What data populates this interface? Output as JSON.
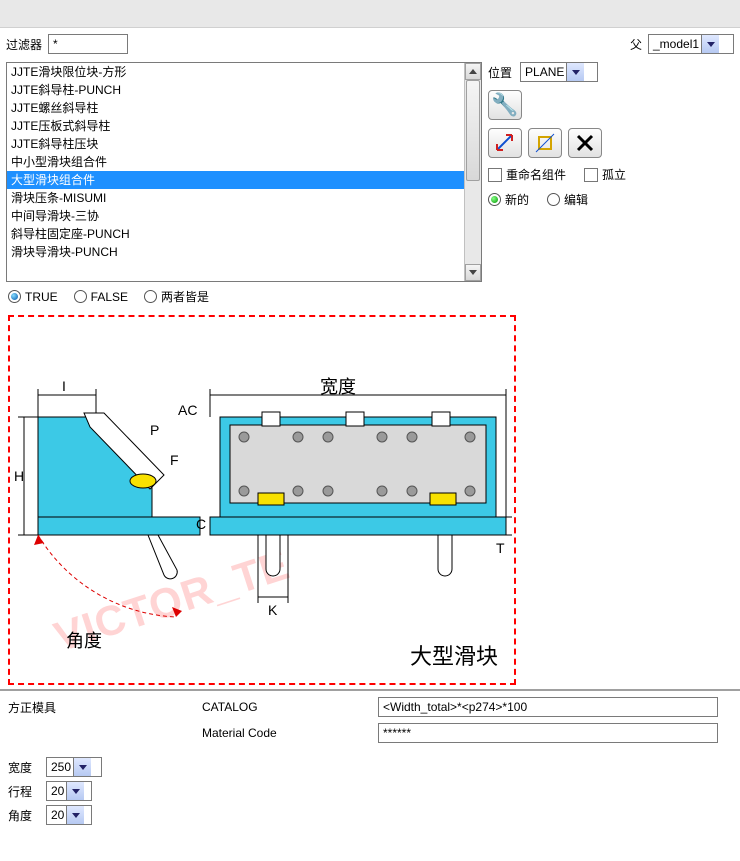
{
  "filter": {
    "label": "过滤器",
    "value": "*"
  },
  "parent": {
    "label": "父",
    "value": "_model1"
  },
  "listbox": {
    "items": [
      "JJTE滑块限位块-方形",
      "JJTE斜导柱-PUNCH",
      "JJTE螺丝斜导柱",
      "JJTE压板式斜导柱",
      "JJTE斜导柱压块",
      "中小型滑块组合件",
      "大型滑块组合件",
      "滑块压条-MISUMI",
      "中间导滑块-三协",
      "斜导柱固定座-PUNCH",
      "滑块导滑块-PUNCH"
    ],
    "selected_index": 6
  },
  "position": {
    "label": "位置",
    "value": "PLANE"
  },
  "rename_chk": "重命名组件",
  "isolate_chk": "孤立",
  "radio_new": "新的",
  "radio_edit": "编辑",
  "truefalse": {
    "true": "TRUE",
    "false": "FALSE",
    "both": "两者皆是"
  },
  "preview": {
    "caption": "大型滑块",
    "width_label": "宽度",
    "angle_label": "角度",
    "dim_i": "I",
    "dim_ac": "AC",
    "dim_p": "P",
    "dim_f": "F",
    "dim_h": "H",
    "dim_c": "C",
    "dim_k": "K",
    "dim_t": "T",
    "watermark": "VICTOR_TE"
  },
  "mold": {
    "row1_label": "方正模具",
    "row1_mid": "CATALOG",
    "row1_value": "<Width_total>*<p274>*100",
    "row2_mid": "Material Code",
    "row2_value": "******"
  },
  "params": {
    "width": {
      "label": "宽度",
      "value": "250"
    },
    "travel": {
      "label": "行程",
      "value": "20"
    },
    "angle": {
      "label": "角度",
      "value": "20"
    }
  },
  "icons": {
    "wrench": "wrench-icon",
    "swap": "swap-icon",
    "rect": "rect-icon",
    "delete": "delete-icon"
  }
}
